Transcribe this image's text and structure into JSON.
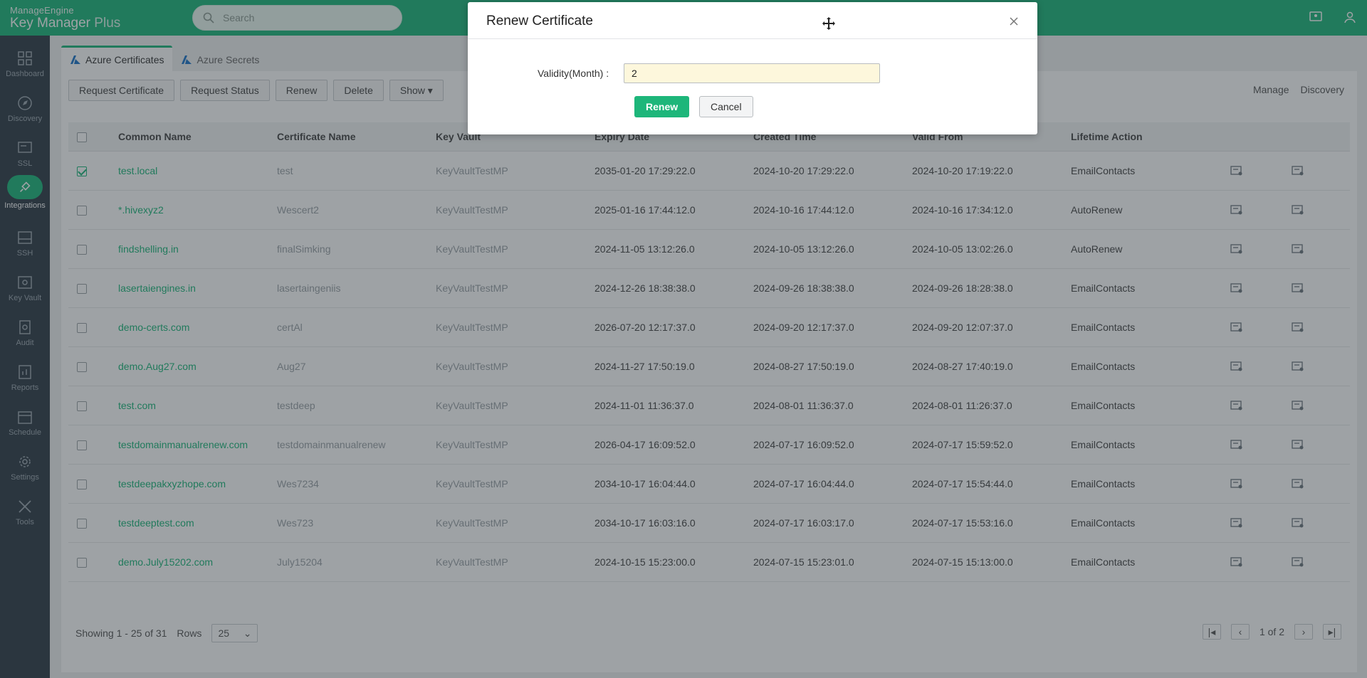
{
  "header": {
    "brand_top": "ManageEngine",
    "brand_main": "Key Manager",
    "brand_suffix": "Plus",
    "search_placeholder": "Search"
  },
  "sidebar": {
    "items": [
      {
        "label": "Dashboard",
        "icon": "dashboard-icon"
      },
      {
        "label": "Discovery",
        "icon": "compass-icon"
      },
      {
        "label": "SSL",
        "icon": "certificate-icon"
      },
      {
        "label": "Integrations",
        "icon": "plug-icon",
        "active": true
      },
      {
        "label": "SSH",
        "icon": "terminal-icon"
      },
      {
        "label": "Key Vault",
        "icon": "vault-icon"
      },
      {
        "label": "Audit",
        "icon": "audit-icon"
      },
      {
        "label": "Reports",
        "icon": "reports-icon"
      },
      {
        "label": "Schedule",
        "icon": "calendar-icon"
      },
      {
        "label": "Settings",
        "icon": "gear-icon"
      },
      {
        "label": "Tools",
        "icon": "tools-icon"
      }
    ]
  },
  "tabs": [
    {
      "label": "Azure Certificates",
      "active": true
    },
    {
      "label": "Azure Secrets",
      "active": false
    }
  ],
  "toolbar": {
    "request_certificate": "Request Certificate",
    "request_status": "Request Status",
    "renew": "Renew",
    "delete": "Delete",
    "show": "Show",
    "manage": "Manage",
    "discovery": "Discovery"
  },
  "table": {
    "headers": [
      "Common Name",
      "Certificate Name",
      "Key Vault",
      "Expiry Date",
      "Created Time",
      "Valid From",
      "Lifetime Action"
    ],
    "rows": [
      {
        "cn": "test.local",
        "cert": "test",
        "vault": "KeyVaultTestMP",
        "expiry": "2035-01-20 17:29:22.0",
        "created": "2024-10-20 17:29:22.0",
        "valid": "2024-10-20 17:19:22.0",
        "action": "EmailContacts",
        "checked": true
      },
      {
        "cn": "*.hivexyz2",
        "cert": "Wescert2",
        "vault": "KeyVaultTestMP",
        "expiry": "2025-01-16 17:44:12.0",
        "created": "2024-10-16 17:44:12.0",
        "valid": "2024-10-16 17:34:12.0",
        "action": "AutoRenew",
        "checked": false
      },
      {
        "cn": "findshelling.in",
        "cert": "finalSimking",
        "vault": "KeyVaultTestMP",
        "expiry": "2024-11-05 13:12:26.0",
        "created": "2024-10-05 13:12:26.0",
        "valid": "2024-10-05 13:02:26.0",
        "action": "AutoRenew",
        "checked": false
      },
      {
        "cn": "lasertaiengines.in",
        "cert": "lasertaingeniis",
        "vault": "KeyVaultTestMP",
        "expiry": "2024-12-26 18:38:38.0",
        "created": "2024-09-26 18:38:38.0",
        "valid": "2024-09-26 18:28:38.0",
        "action": "EmailContacts",
        "checked": false
      },
      {
        "cn": "demo-certs.com",
        "cert": "certAl",
        "vault": "KeyVaultTestMP",
        "expiry": "2026-07-20 12:17:37.0",
        "created": "2024-09-20 12:17:37.0",
        "valid": "2024-09-20 12:07:37.0",
        "action": "EmailContacts",
        "checked": false
      },
      {
        "cn": "demo.Aug27.com",
        "cert": "Aug27",
        "vault": "KeyVaultTestMP",
        "expiry": "2024-11-27 17:50:19.0",
        "created": "2024-08-27 17:50:19.0",
        "valid": "2024-08-27 17:40:19.0",
        "action": "EmailContacts",
        "checked": false
      },
      {
        "cn": "test.com",
        "cert": "testdeep",
        "vault": "KeyVaultTestMP",
        "expiry": "2024-11-01 11:36:37.0",
        "created": "2024-08-01 11:36:37.0",
        "valid": "2024-08-01 11:26:37.0",
        "action": "EmailContacts",
        "checked": false
      },
      {
        "cn": "testdomainmanualrenew.com",
        "cert": "testdomainmanualrenew",
        "vault": "KeyVaultTestMP",
        "expiry": "2026-04-17 16:09:52.0",
        "created": "2024-07-17 16:09:52.0",
        "valid": "2024-07-17 15:59:52.0",
        "action": "EmailContacts",
        "checked": false
      },
      {
        "cn": "testdeepakxyzhope.com",
        "cert": "Wes7234",
        "vault": "KeyVaultTestMP",
        "expiry": "2034-10-17 16:04:44.0",
        "created": "2024-07-17 16:04:44.0",
        "valid": "2024-07-17 15:54:44.0",
        "action": "EmailContacts",
        "checked": false
      },
      {
        "cn": "testdeeptest.com",
        "cert": "Wes723",
        "vault": "KeyVaultTestMP",
        "expiry": "2034-10-17 16:03:16.0",
        "created": "2024-07-17 16:03:17.0",
        "valid": "2024-07-17 15:53:16.0",
        "action": "EmailContacts",
        "checked": false
      },
      {
        "cn": "demo.July15202.com",
        "cert": "July15204",
        "vault": "KeyVaultTestMP",
        "expiry": "2024-10-15 15:23:00.0",
        "created": "2024-07-15 15:23:01.0",
        "valid": "2024-07-15 15:13:00.0",
        "action": "EmailContacts",
        "checked": false
      }
    ]
  },
  "footer": {
    "showing": "Showing 1 - 25 of 31",
    "rows_label": "Rows",
    "rows_value": "25",
    "page_info": "1 of 2"
  },
  "modal": {
    "title": "Renew Certificate",
    "validity_label": "Validity(Month) :",
    "validity_value": "2",
    "renew_button": "Renew",
    "cancel_button": "Cancel"
  },
  "colors": {
    "accent": "#1db67a",
    "sidebar": "#2f3b46"
  }
}
